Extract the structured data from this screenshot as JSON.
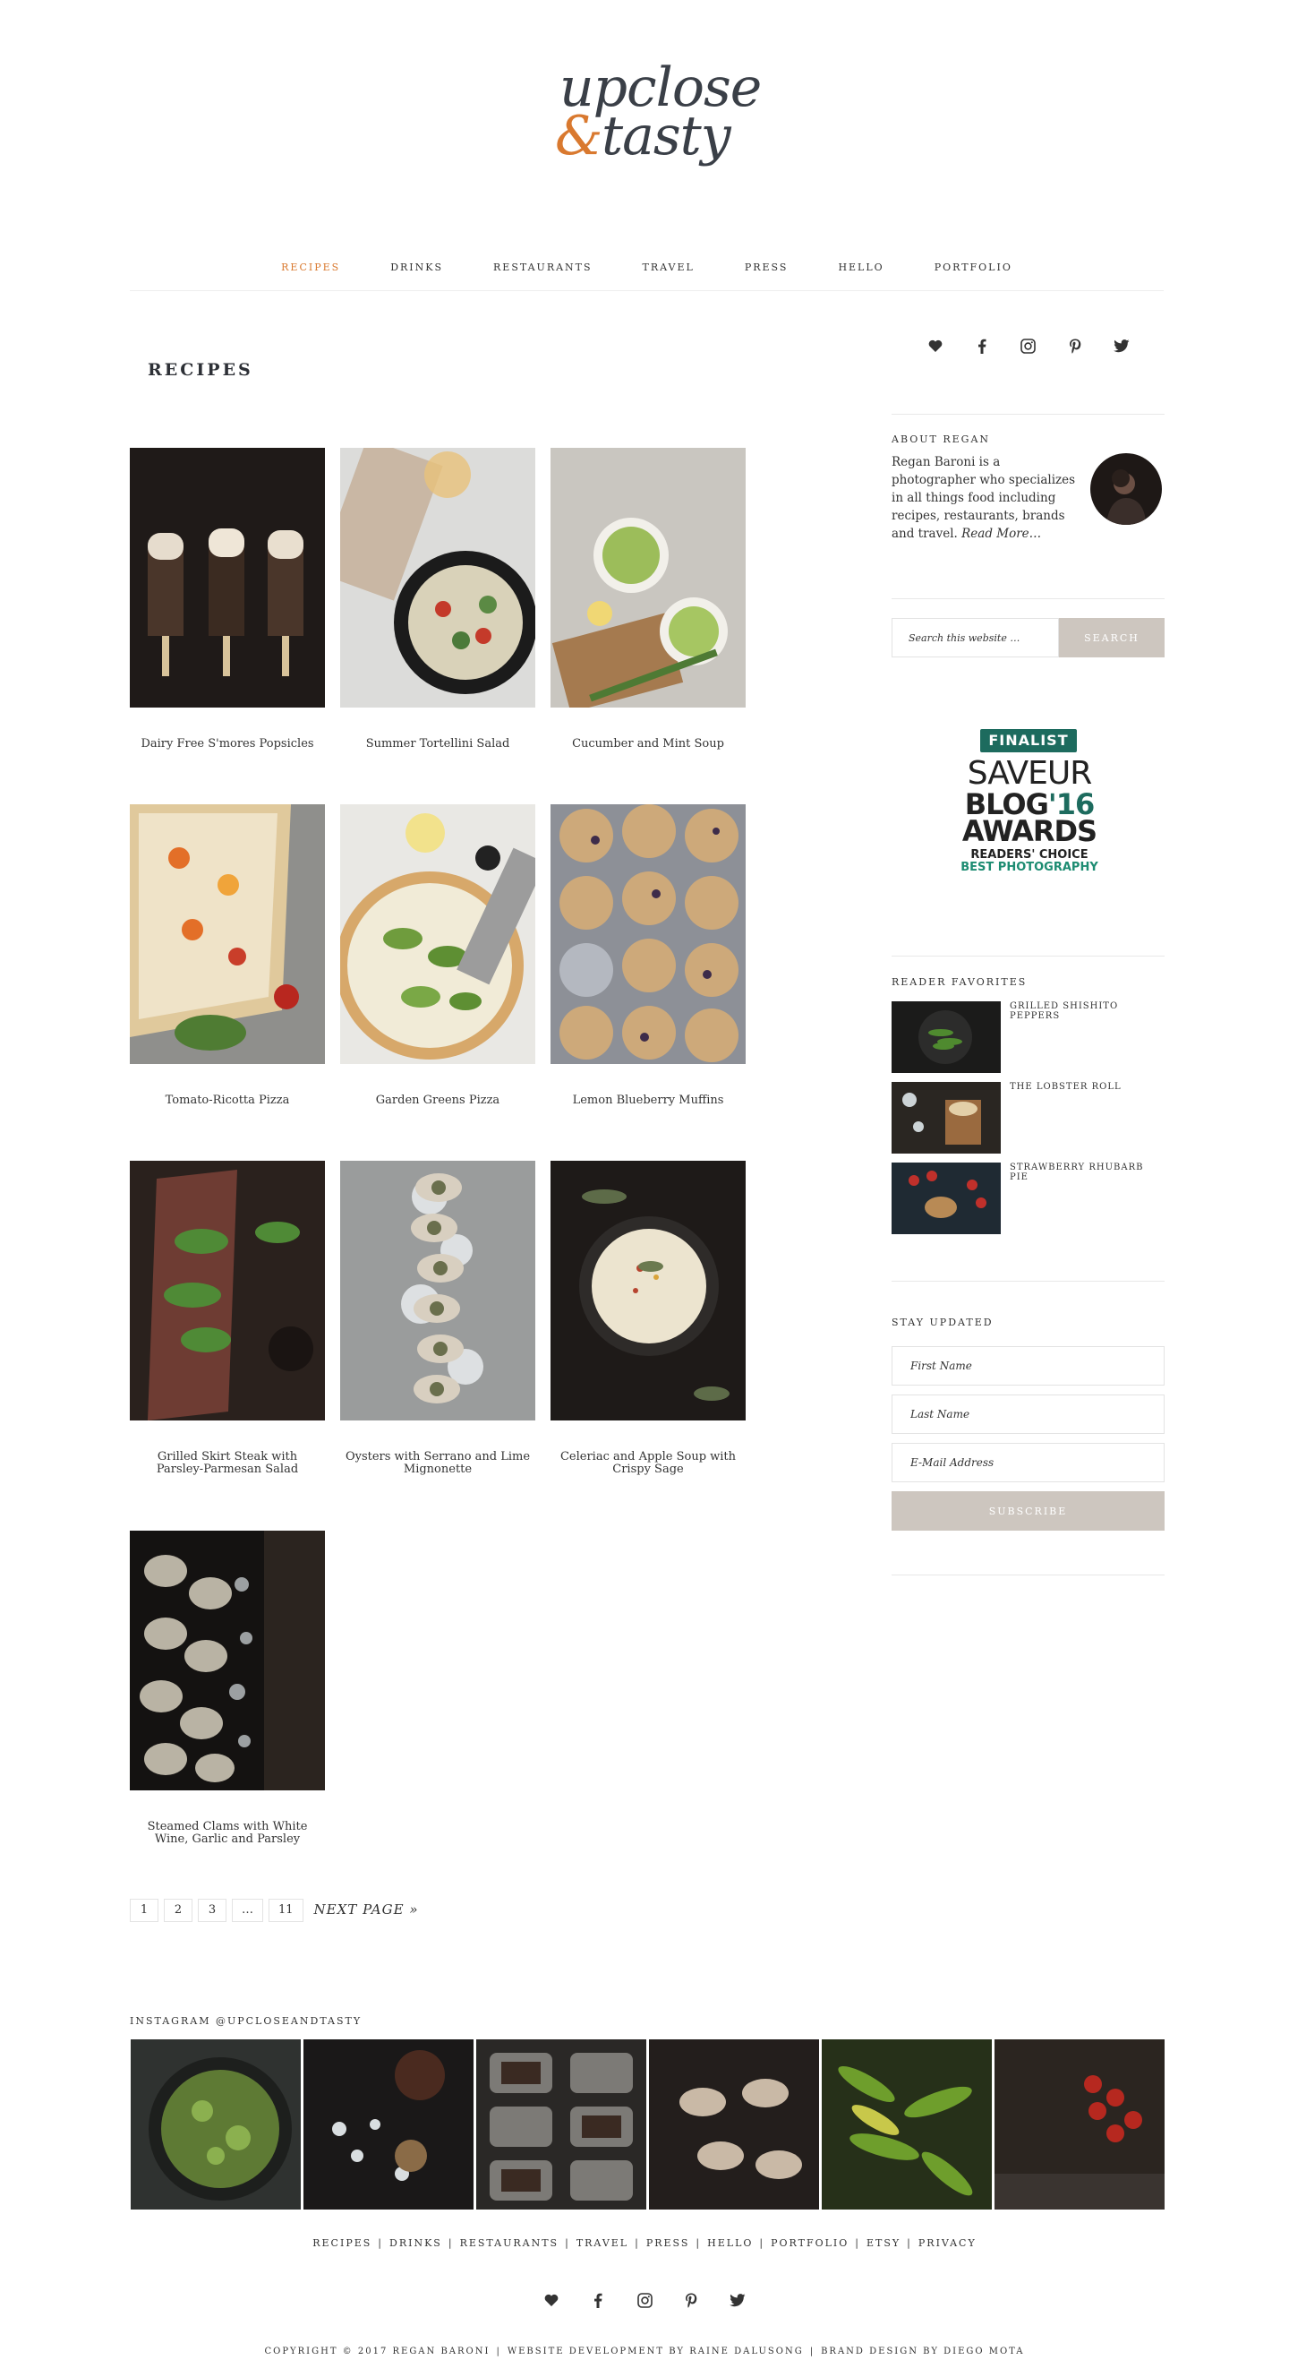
{
  "site": {
    "logo_line1": "upclose",
    "logo_amp": "&",
    "logo_line2": "tasty",
    "accent_color": "#d9792f"
  },
  "nav": [
    {
      "label": "RECIPES",
      "active": true
    },
    {
      "label": "DRINKS"
    },
    {
      "label": "RESTAURANTS"
    },
    {
      "label": "TRAVEL"
    },
    {
      "label": "PRESS"
    },
    {
      "label": "HELLO"
    },
    {
      "label": "PORTFOLIO"
    }
  ],
  "page_title": "RECIPES",
  "recipes": [
    {
      "title": "Dairy Free S'mores Popsicles"
    },
    {
      "title": "Summer Tortellini Salad"
    },
    {
      "title": "Cucumber and Mint Soup"
    },
    {
      "title": "Tomato-Ricotta Pizza"
    },
    {
      "title": "Garden Greens Pizza"
    },
    {
      "title": "Lemon Blueberry Muffins"
    },
    {
      "title": "Grilled Skirt Steak with Parsley-Parmesan Salad"
    },
    {
      "title": "Oysters with Serrano and Lime Mignonette"
    },
    {
      "title": "Celeriac and Apple Soup with Crispy Sage"
    },
    {
      "title": "Steamed Clams with White Wine, Garlic and Parsley"
    }
  ],
  "pagination": {
    "pages": [
      "1",
      "2",
      "3",
      "…",
      "11"
    ],
    "next": "NEXT PAGE »"
  },
  "sidebar": {
    "social_icons": [
      "heart-icon",
      "facebook-icon",
      "instagram-icon",
      "pinterest-icon",
      "twitter-icon"
    ],
    "about": {
      "title": "ABOUT REGAN",
      "text": "Regan Baroni is a photographer who specializes in all things food including recipes, restaurants, brands and travel.",
      "read_more": "Read More…"
    },
    "search": {
      "placeholder": "Search this website …",
      "button": "SEARCH"
    },
    "badge": {
      "finalist": "FINALIST",
      "saveur": "SAVEUR",
      "blog": "BLOG",
      "year": "'16",
      "awards": "AWARDS",
      "readers_choice": "READERS' CHOICE",
      "category": "BEST PHOTOGRAPHY"
    },
    "favorites": {
      "title": "READER FAVORITES",
      "items": [
        {
          "title": "GRILLED SHISHITO PEPPERS"
        },
        {
          "title": "THE LOBSTER ROLL"
        },
        {
          "title": "STRAWBERRY RHUBARB PIE"
        }
      ]
    },
    "newsletter": {
      "title": "STAY UPDATED",
      "first_name": "First Name",
      "last_name": "Last Name",
      "email": "E-Mail Address",
      "button": "SUBSCRIBE"
    }
  },
  "instagram": {
    "title": "INSTAGRAM @UPCLOSEANDTASTY"
  },
  "footer": {
    "links": [
      "RECIPES",
      "DRINKS",
      "RESTAURANTS",
      "TRAVEL",
      "PRESS",
      "HELLO",
      "PORTFOLIO",
      "ETSY",
      "PRIVACY"
    ],
    "separator": "|",
    "copyright": "COPYRIGHT © 2017 REGAN BARONI",
    "dev_credit": "WEBSITE DEVELOPMENT BY RAINE DALUSONG",
    "design_credit": "BRAND DESIGN BY DIEGO MOTA"
  }
}
